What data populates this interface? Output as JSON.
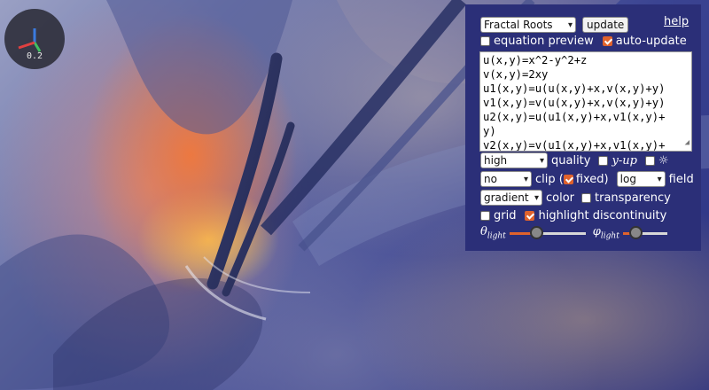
{
  "gizmo": {
    "scale_label": "0.2"
  },
  "panel": {
    "preset": {
      "selected": "Fractal Roots"
    },
    "update_label": "update",
    "help_label": "help",
    "equation_preview": {
      "label": "equation preview",
      "checked": false
    },
    "auto_update": {
      "label": "auto-update",
      "checked": true
    },
    "equations": [
      "u(x,y)=x^2-y^2+z",
      "v(x,y)=2xy",
      "u1(x,y)=u(u(x,y)+x,v(x,y)+y)",
      "v1(x,y)=v(u(x,y)+x,v(x,y)+y)",
      "u2(x,y)=u(u1(x,y)+x,v1(x,y)+",
      "y)",
      "v2(x,y)=v(u1(x,y)+x,v1(x,y)+"
    ],
    "quality": {
      "selected": "high",
      "label": "quality"
    },
    "y_up": {
      "label": "y-up",
      "checked": false
    },
    "light_toggle": {
      "icon": "sun-icon",
      "glyph": "☼",
      "checked": false
    },
    "clip": {
      "selected": "no",
      "label": "clip ("
    },
    "fixed": {
      "label": "fixed)",
      "checked": true
    },
    "field": {
      "selected": "log",
      "label": "field"
    },
    "color": {
      "selected": "gradient",
      "label": "color"
    },
    "transparency": {
      "label": "transparency",
      "checked": false
    },
    "grid": {
      "label": "grid",
      "checked": false
    },
    "highlight_discontinuity": {
      "label": "highlight discontinuity",
      "checked": true
    },
    "theta_light": {
      "symbol": "θ",
      "subscript": "light",
      "value_fraction": 0.33
    },
    "phi_light": {
      "symbol": "φ",
      "subscript": "light",
      "value_fraction": 0.2
    }
  },
  "colors": {
    "accent": "#e0622c",
    "panel_bg": "#2b2f78"
  }
}
